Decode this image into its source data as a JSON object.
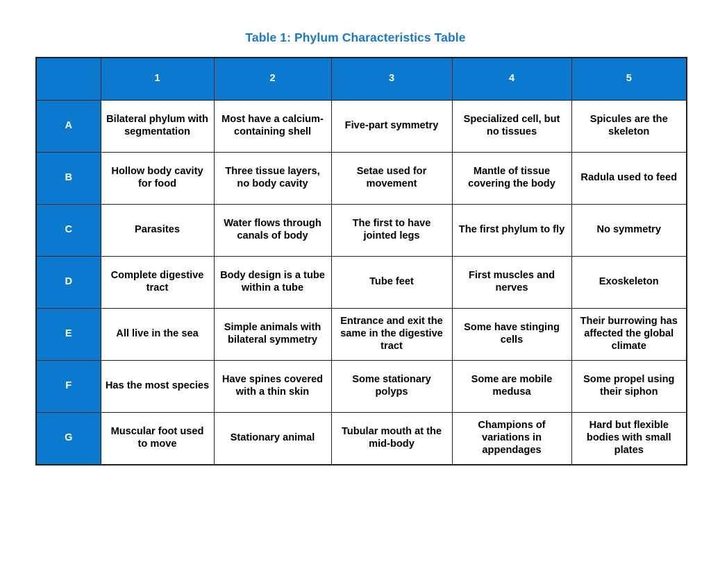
{
  "title": "Table 1: Phylum Characteristics Table",
  "colors": {
    "header_blue": "#0b79ce",
    "title_blue": "#1878cd",
    "border": "#231f20",
    "cell_background": "#ffffff",
    "header_text": "#ffffff",
    "cell_text": "#000000"
  },
  "table": {
    "corner_label": "",
    "column_headers": [
      "1",
      "2",
      "3",
      "4",
      "5"
    ],
    "row_labels": [
      "A",
      "B",
      "C",
      "D",
      "E",
      "F",
      "G"
    ],
    "rows": [
      {
        "label": "A",
        "cells": [
          "Bilateral phylum with segmentation",
          "Most have a calcium-containing shell",
          "Five-part symmetry",
          "Specialized cell, but no tissues",
          "Spicules are the skeleton"
        ]
      },
      {
        "label": "B",
        "cells": [
          "Hollow body cavity for food",
          "Three tissue layers, no body cavity",
          "Setae used for movement",
          "Mantle of tissue covering the body",
          "Radula used to feed"
        ]
      },
      {
        "label": "C",
        "cells": [
          "Parasites",
          "Water flows through canals of body",
          "The first to have jointed legs",
          "The first phylum to fly",
          "No symmetry"
        ]
      },
      {
        "label": "D",
        "cells": [
          "Complete digestive tract",
          "Body design is a tube within a tube",
          "Tube feet",
          "First muscles and nerves",
          "Exoskeleton"
        ]
      },
      {
        "label": "E",
        "cells": [
          "All live in the sea",
          "Simple animals with bilateral symmetry",
          "Entrance and exit the same in the digestive tract",
          "Some have stinging cells",
          "Their burrowing has affected the global climate"
        ]
      },
      {
        "label": "F",
        "cells": [
          "Has the most species",
          "Have spines covered with a thin skin",
          "Some stationary polyps",
          "Some are mobile medusa",
          "Some propel using their siphon"
        ]
      },
      {
        "label": "G",
        "cells": [
          "Muscular foot used to move",
          "Stationary animal",
          "Tubular mouth at the mid-body",
          "Champions of variations in appendages",
          "Hard but flexible bodies with small plates"
        ]
      }
    ]
  }
}
